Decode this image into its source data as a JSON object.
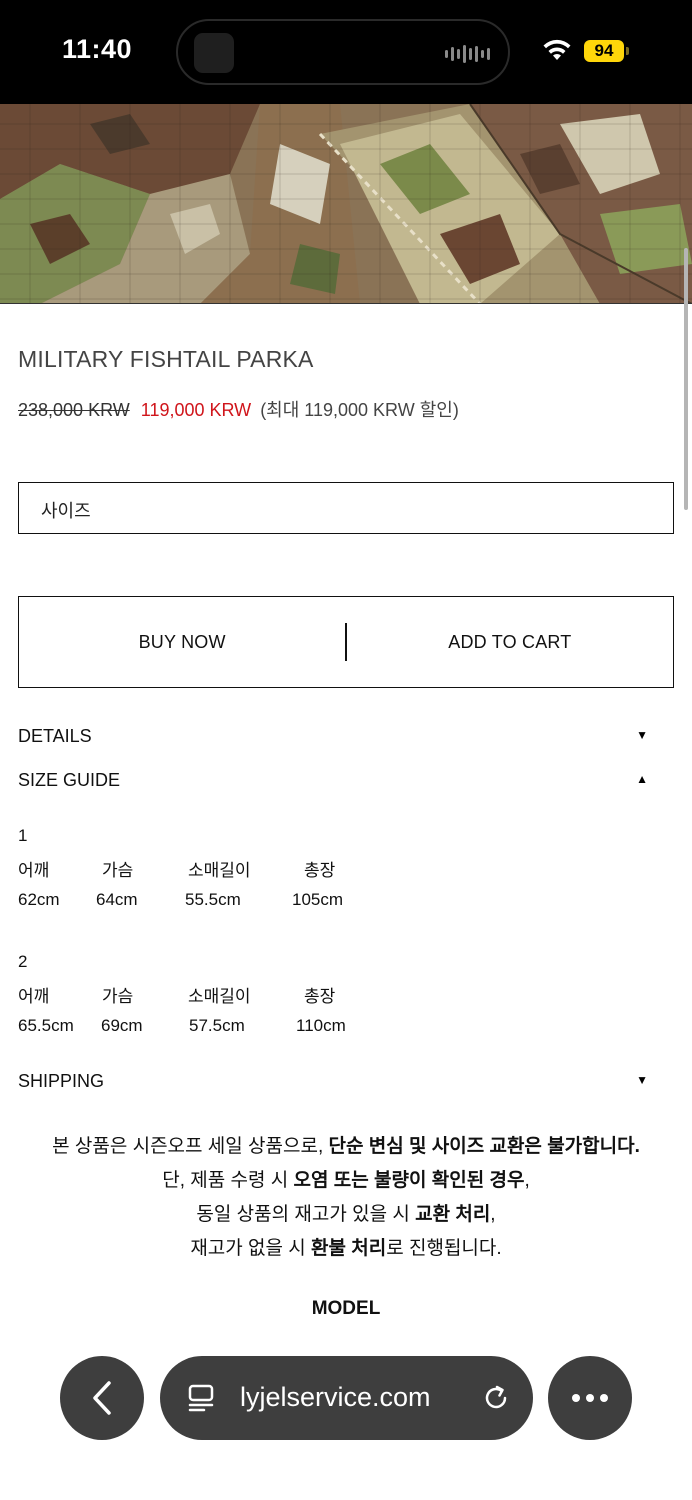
{
  "status_bar": {
    "time": "11:40",
    "battery": "94",
    "icons": [
      "wifi-icon",
      "battery-icon",
      "audio-wave-icon"
    ]
  },
  "product": {
    "title": "MILITARY FISHTAIL PARKA",
    "price_original": "238,000 KRW",
    "price_sale": "119,000 KRW",
    "price_discount_note": "(최대 119,000 KRW 할인)"
  },
  "size_select": {
    "placeholder": "사이즈"
  },
  "actions": {
    "buy_now": "BUY NOW",
    "add_to_cart": "ADD TO CART"
  },
  "accordion": {
    "details": "DETAILS",
    "size_guide": "SIZE GUIDE",
    "shipping": "SHIPPING"
  },
  "size_guide": {
    "sizes": [
      {
        "label": "1",
        "headers": [
          "어깨",
          "가슴",
          "소매길이",
          "총장"
        ],
        "values": [
          "62cm",
          "64cm",
          "55.5cm",
          "105cm"
        ]
      },
      {
        "label": "2",
        "headers": [
          "어깨",
          "가슴",
          "소매길이",
          "총장"
        ],
        "values": [
          "65.5cm",
          "69cm",
          "57.5cm",
          "110cm"
        ]
      }
    ]
  },
  "notice": {
    "line1_a": "본 상품은 시즌오프 세일 상품으로, ",
    "line1_b": "단순 변심 및 사이즈 교환은 불가합니다.",
    "line2_a": "단, 제품 수령 시 ",
    "line2_b": "오염 또는 불량이 확인된 경우",
    "line2_c": ",",
    "line3_a": "동일 상품의 재고가 있을 시 ",
    "line3_b": "교환 처리",
    "line3_c": ",",
    "line4_a": "재고가 없을 시 ",
    "line4_b": "환불 처리",
    "line4_c": "로 진행됩니다."
  },
  "model_heading": "MODEL",
  "browser": {
    "url": "lyjelservice.com"
  },
  "colors": {
    "sale_red": "#d0151b",
    "battery_yellow": "#ffd60a",
    "pill_gray": "#3e3e3e"
  }
}
